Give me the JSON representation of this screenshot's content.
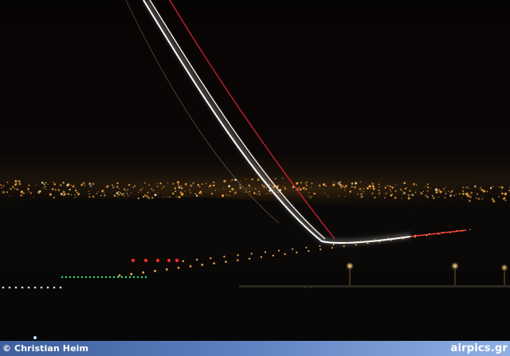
{
  "photo": {
    "colors": {
      "sky": "#080504",
      "city_lights": "#f2a63a",
      "trail_white": "#ffffff",
      "trail_red": "#e0202a",
      "runway_green": "#2fe07a",
      "runway_red": "#ff2a2a"
    }
  },
  "credit": {
    "photographer": "© Christian Heim",
    "site": "airpics.gr"
  },
  "colors": {
    "bar_start": "#3e5f9c",
    "bar_end": "#8fb0e3",
    "text": "#ffffff"
  }
}
